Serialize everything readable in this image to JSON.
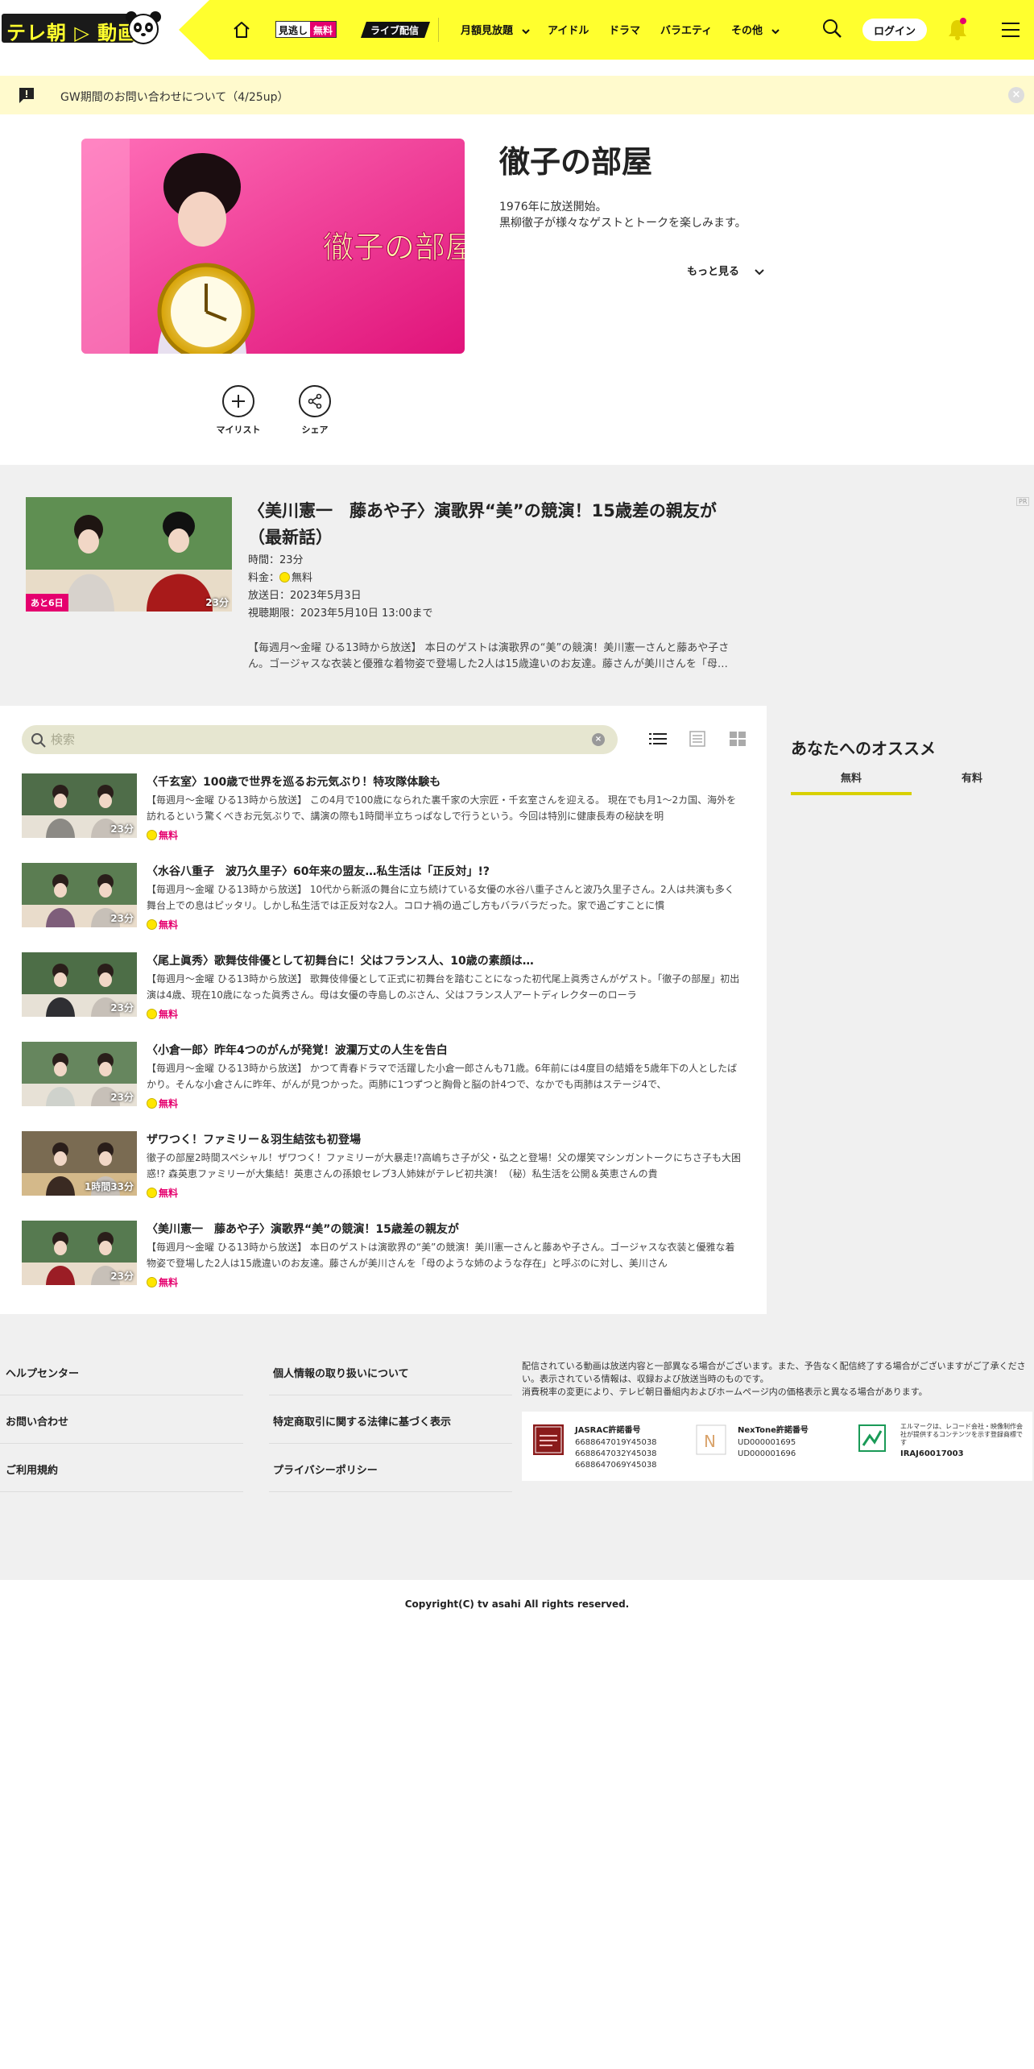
{
  "header": {
    "logo_text": "テレ朝",
    "logo_text2": "動画",
    "nav": {
      "mino_a": "見逃し",
      "mino_b": "無料",
      "live": "ライブ配信",
      "monthly": "月額見放題",
      "idol": "アイドル",
      "drama": "ドラマ",
      "variety": "バラエティ",
      "other": "その他"
    },
    "login": "ログイン"
  },
  "notice": {
    "text": "GW期間のお問い合わせについて（4/25up）"
  },
  "program": {
    "title": "徹子の部屋",
    "desc1": "1976年に放送開始。",
    "desc2": "黒柳徹子が様々なゲストとトークを楽しみます。",
    "more": "もっと見る",
    "mylist": "マイリスト",
    "share": "シェア",
    "img_text": "徹子の部屋"
  },
  "featured": {
    "title": "〈美川憲一　藤あや子〉演歌界“美”の競演！15歳差の親友が（最新話）",
    "time": "時間：23分",
    "fee_label": "料金：",
    "fee": "無料",
    "aired": "放送日：2023年5月3日",
    "period": "視聴期限：2023年5月10日 13:00まで",
    "body": "【毎週月～金曜 ひる13時から放送】 本日のゲストは演歌界の“美”の競演！美川憲一さんと藤あや子さん。ゴージャスな衣装と優雅な着物姿で登場した2人は15歳違いのお友達。藤さんが美川さんを「母…",
    "tag": "あと6日",
    "duration": "23分",
    "ad": "PR"
  },
  "search": {
    "placeholder": "検索",
    "value": ""
  },
  "episodes": [
    {
      "title": "〈千玄室〉100歳で世界を巡るお元気ぶり！特攻隊体験も",
      "desc": "【毎週月～金曜 ひる13時から放送】 この4月で100歳になられた裏千家の大宗匠・千玄室さんを迎える。 現在でも月1～2カ国、海外を訪れるという驚くべきお元気ぶりで、講演の際も1時間半立ちっぱなしで行うという。今回は特別に健康長寿の秘訣を明",
      "price": "無料",
      "duration": "23分"
    },
    {
      "title": "〈水谷八重子　波乃久里子〉60年来の盟友…私生活は「正反対」!?",
      "desc": "【毎週月～金曜 ひる13時から放送】 10代から新派の舞台に立ち続けている女優の水谷八重子さんと波乃久里子さん。2人は共演も多く舞台上での息はピッタリ。しかし私生活では正反対な2人。コロナ禍の過ごし方もバラバラだった。家で過ごすことに慣",
      "price": "無料",
      "duration": "23分"
    },
    {
      "title": "〈尾上眞秀〉歌舞伎俳優として初舞台に！父はフランス人、10歳の素顔は…",
      "desc": "【毎週月～金曜 ひる13時から放送】 歌舞伎俳優として正式に初舞台を踏むことになった初代尾上眞秀さんがゲスト。「徹子の部屋」初出演は4歳、現在10歳になった眞秀さん。母は女優の寺島しのぶさん、父はフランス人アートディレクターのローラ",
      "price": "無料",
      "duration": "23分"
    },
    {
      "title": "〈小倉一郎〉昨年4つのがんが発覚！波瀾万丈の人生を告白",
      "desc": "【毎週月～金曜 ひる13時から放送】 かつて青春ドラマで活躍した小倉一郎さんも71歳。6年前には4度目の結婚を5歳年下の人としたばかり。そんな小倉さんに昨年、がんが見つかった。両肺に1つずつと胸骨と脳の計4つで、なかでも両肺はステージ4で、",
      "price": "無料",
      "duration": "23分"
    },
    {
      "title": "ザワつく！ファミリー＆羽生結弦も初登場",
      "desc": "徹子の部屋2時間スペシャル！ザワつく！ファミリーが大暴走!?高嶋ちさ子が父・弘之と登場！父の爆笑マシンガントークにちさ子も大困惑!? 森英恵ファミリーが大集結！英恵さんの孫娘セレブ3人姉妹がテレビ初共演！（秘）私生活を公開＆英恵さんの貴",
      "price": "無料",
      "duration": "1時間33分"
    },
    {
      "title": "〈美川憲一　藤あや子〉演歌界“美”の競演！15歳差の親友が",
      "desc": "【毎週月～金曜 ひる13時から放送】 本日のゲストは演歌界の“美”の競演！美川憲一さんと藤あや子さん。ゴージャスな衣装と優雅な着物姿で登場した2人は15歳違いのお友達。藤さんが美川さんを「母のような姉のような存在」と呼ぶのに対し、美川さん",
      "price": "無料",
      "duration": "23分"
    }
  ],
  "recommend": {
    "title": "あなたへのオススメ",
    "tab_free": "無料",
    "tab_paid": "有料"
  },
  "footer": {
    "links": [
      "ヘルプセンター",
      "お問い合わせ",
      "ご利用規約",
      "個人情報の取り扱いについて",
      "特定商取引に関する法律に基づく表示",
      "プライバシーポリシー"
    ],
    "note1": "配信されている動画は放送内容と一部異なる場合がございます。また、予告なく配信終了する場合がございますがご了承ください。表示されている情報は、収録および放送当時のものです。",
    "note2": "消費税率の変更により、テレビ朝日番組内およびホームページ内の価格表示と異なる場合があります。",
    "jasrac_title": "JASRAC許諾番号",
    "jasrac_nums": [
      "6688647019Y45038",
      "6688647032Y45038",
      "6688647069Y45038"
    ],
    "nextone_title": "NexTone許諾番号",
    "nextone_nums": [
      "UD000001695",
      "UD000001696"
    ],
    "elmark_text": "エルマークは、レコード会社・映像制作会社が提供するコンテンツを示す登録商標です",
    "elmark_num": "IRAJ60017003",
    "copyright": "Copyright(C) tv asahi All rights reserved."
  },
  "colors": {
    "brand_yellow": "#ffff2e",
    "accent_pink": "#e5006e",
    "notice_bg": "#fffacd",
    "section_gray": "#f0f0f0"
  }
}
